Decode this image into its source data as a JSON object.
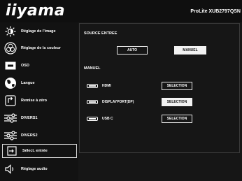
{
  "header": {
    "logo": "iiyama",
    "model": "ProLite XUB2797QSN"
  },
  "sidebar": {
    "items": [
      {
        "label": "Réglage de l'image",
        "icon": "brightness-icon"
      },
      {
        "label": "Réglage de la couleur",
        "icon": "color-icon"
      },
      {
        "label": "OSD",
        "icon": "osd-icon"
      },
      {
        "label": "Langue",
        "icon": "globe-icon"
      },
      {
        "label": "Remise à zéro",
        "icon": "reset-icon"
      },
      {
        "label": "DIVERS1",
        "icon": "sliders-icon"
      },
      {
        "label": "DIVERS2",
        "icon": "sliders-icon"
      },
      {
        "label": "Sélect. entrée",
        "icon": "input-select-icon",
        "selected": true
      },
      {
        "label": "Réglage audio",
        "icon": "speaker-icon"
      }
    ]
  },
  "main": {
    "source_title": "SOURCE ENTREE",
    "auto_label": "AUTO",
    "manuel_label": "MANUEL",
    "manuel_section_title": "MANUEL",
    "inputs": [
      {
        "label": "HDMI",
        "button": "SELECTION"
      },
      {
        "label": "DISPLAYPORT(DP)",
        "button": "SELECTION"
      },
      {
        "label": "USB C",
        "button": "SELECTION"
      }
    ]
  },
  "colors": {
    "background": "#101010",
    "text": "#ffffff",
    "selected_button_bg": "#f2f2f2",
    "selected_button_text": "#111111"
  }
}
